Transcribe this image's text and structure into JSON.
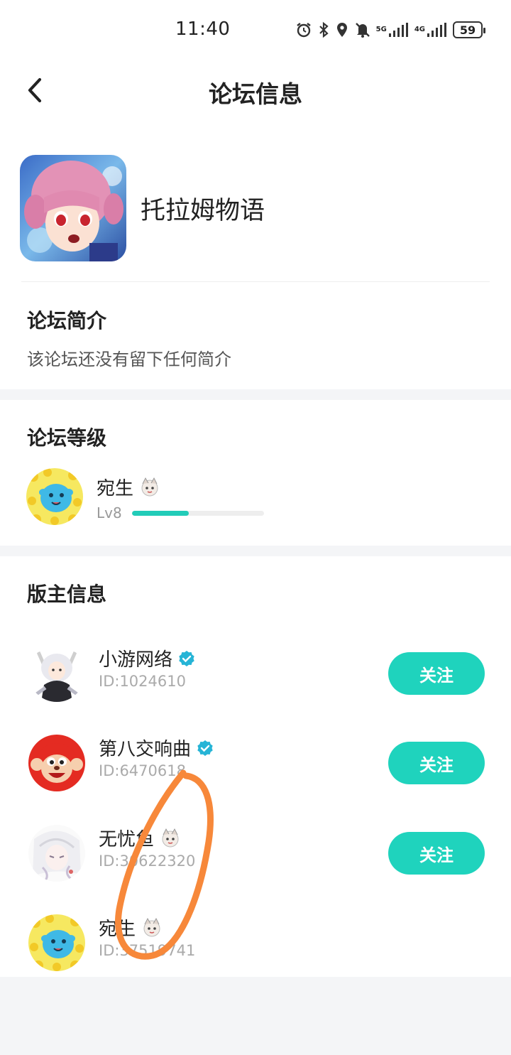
{
  "status_bar": {
    "time": "11:40",
    "icons": [
      "alarm-icon",
      "bluetooth-icon",
      "location-icon",
      "mute-icon",
      "signal-5g-icon",
      "signal-4g-icon",
      "battery-icon"
    ],
    "sig1_label": "5G",
    "sig2_label": "4G",
    "battery": "59"
  },
  "header": {
    "title": "论坛信息"
  },
  "forum": {
    "name": "托拉姆物语",
    "intro_title": "论坛简介",
    "intro_text": "该论坛还没有留下任何简介"
  },
  "level": {
    "title": "论坛等级",
    "user_name": "宛生",
    "level_label": "Lv8",
    "progress": 0.43
  },
  "moderators": {
    "title": "版主信息",
    "follow_label": "关注",
    "items": [
      {
        "name": "小游网络",
        "id": "ID:1024610",
        "badge": "verified-icon",
        "followable": true
      },
      {
        "name": "第八交响曲",
        "id": "ID:6470618",
        "badge": "verified-icon",
        "followable": true
      },
      {
        "name": "无忧鱼",
        "id": "ID:30622320",
        "badge": "mascot-badge-icon",
        "followable": true
      },
      {
        "name": "宛生",
        "id": "ID:37519741",
        "badge": "mascot-badge-icon",
        "followable": false
      }
    ]
  },
  "colors": {
    "accent": "#1fd3bd",
    "annotation": "#f7883a",
    "background": "#f4f5f7"
  }
}
